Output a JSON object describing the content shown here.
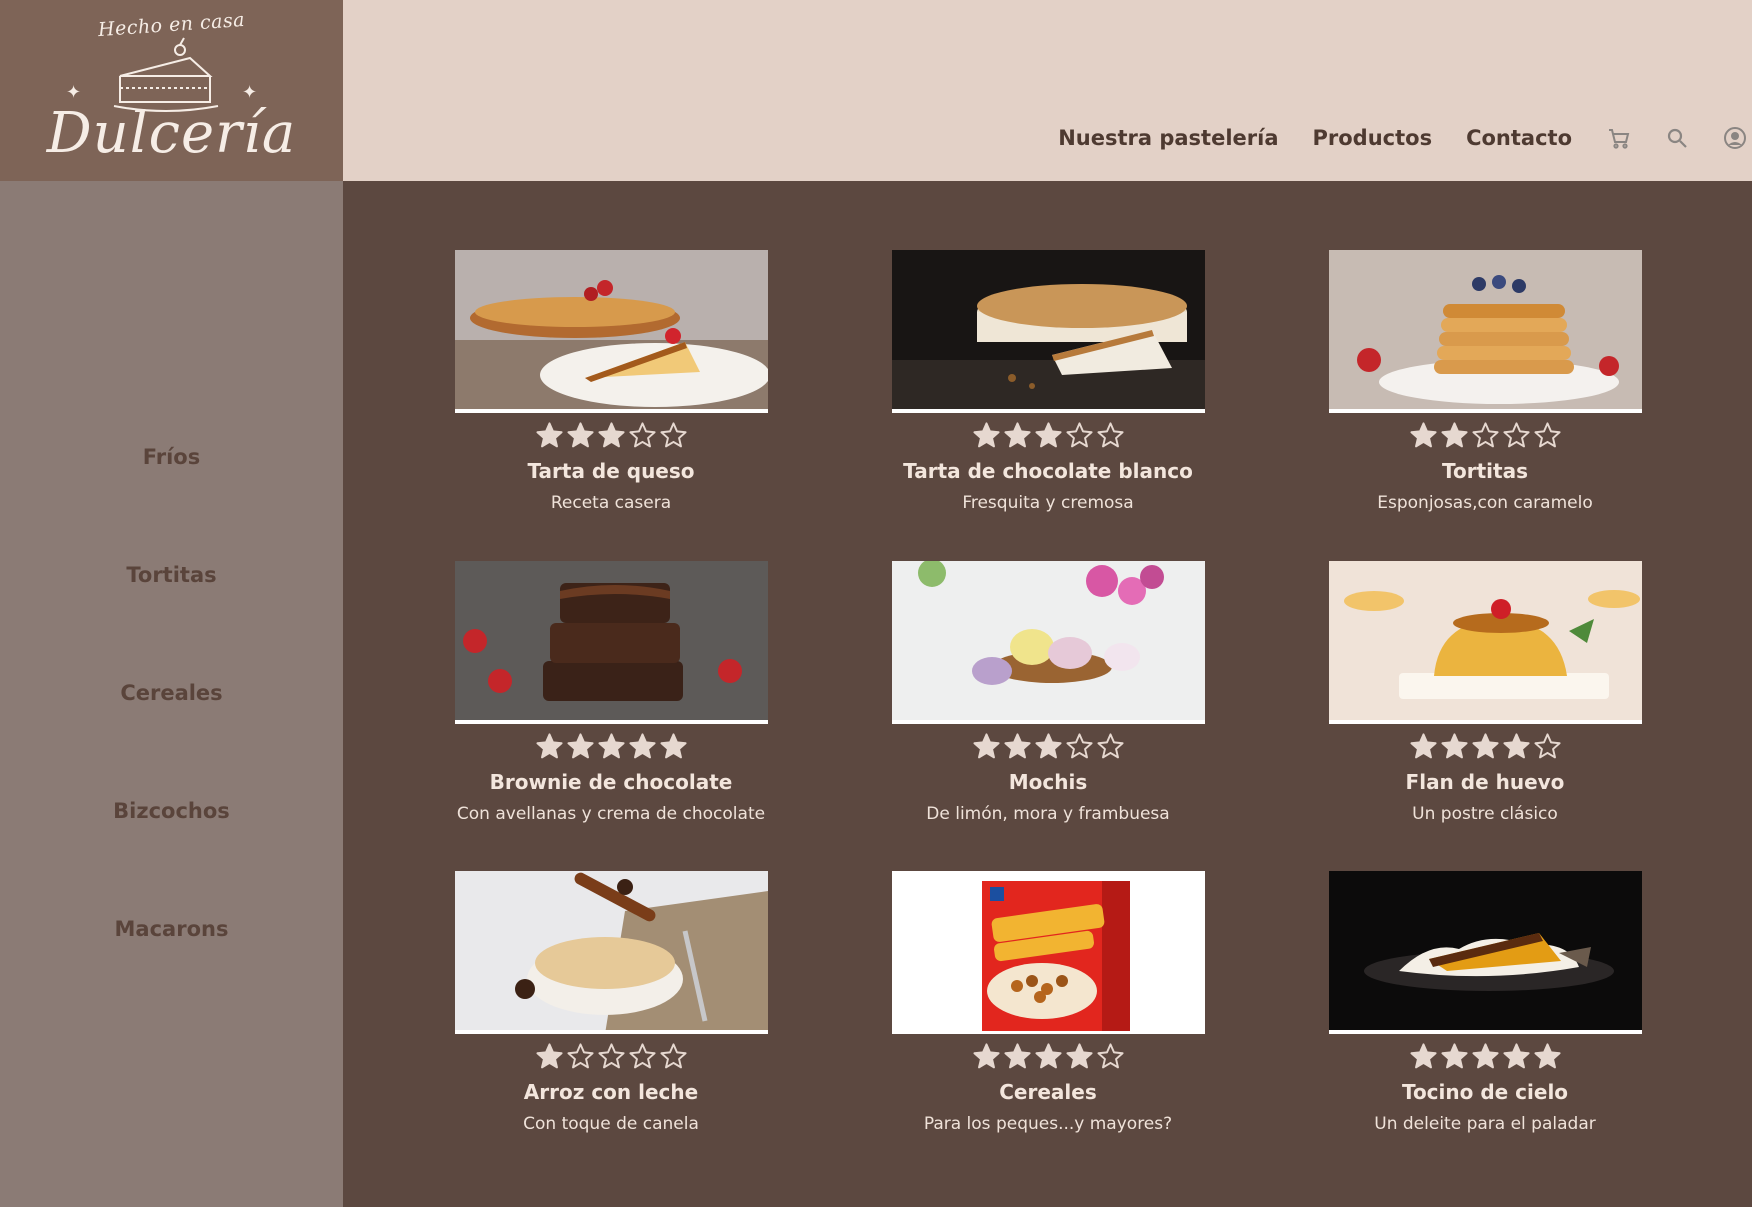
{
  "logo": {
    "tagline": "Hecho en casa",
    "brand": "Dulcería"
  },
  "nav": {
    "links": [
      "Nuestra pastelería",
      "Productos",
      "Contacto"
    ],
    "icons": [
      "cart-icon",
      "search-icon",
      "user-icon"
    ]
  },
  "sidebar": {
    "categories": [
      "Fríos",
      "Tortitas",
      "Cereales",
      "Bizcochos",
      "Macarons"
    ]
  },
  "products": [
    {
      "title": "Tarta de queso",
      "desc": "Receta casera",
      "rating": 3,
      "max": 5
    },
    {
      "title": "Tarta de chocolate blanco",
      "desc": "Fresquita y cremosa",
      "rating": 3,
      "max": 5
    },
    {
      "title": "Tortitas",
      "desc": "Esponjosas,con caramelo",
      "rating": 2,
      "max": 5
    },
    {
      "title": "Brownie de chocolate",
      "desc": "Con avellanas y crema de chocolate",
      "rating": 5,
      "max": 5
    },
    {
      "title": "Mochis",
      "desc": "De limón, mora y frambuesa",
      "rating": 3,
      "max": 5
    },
    {
      "title": "Flan de huevo",
      "desc": "Un postre clásico",
      "rating": 4,
      "max": 5
    },
    {
      "title": "Arroz con leche",
      "desc": "Con toque de canela",
      "rating": 1,
      "max": 5
    },
    {
      "title": "Cereales",
      "desc": "Para los peques...y mayores?",
      "rating": 4,
      "max": 5
    },
    {
      "title": "Tocino de cielo",
      "desc": "Un deleite para el paladar",
      "rating": 5,
      "max": 5
    }
  ],
  "colors": {
    "header_bg": "#e3d1c7",
    "logo_bg": "#7e6457",
    "sidebar_bg": "#8b7b75",
    "main_bg": "#5c4840",
    "star": "#e6d8d0"
  }
}
